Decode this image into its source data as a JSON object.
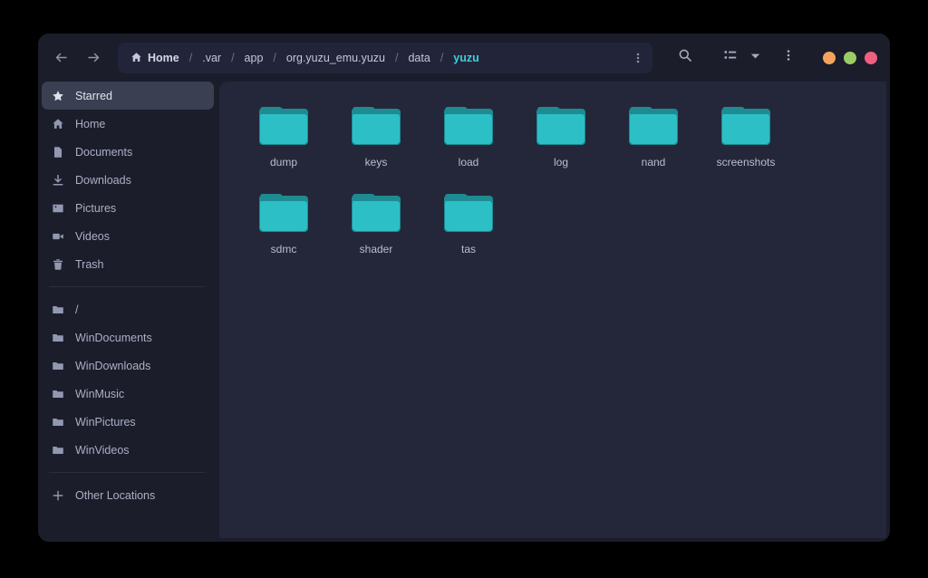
{
  "window": {
    "nav": {
      "back_label": "Back",
      "forward_label": "Forward"
    }
  },
  "breadcrumb": {
    "home_label": "Home",
    "separator": "/",
    "items": [
      {
        "label": "Home",
        "icon": "home-icon",
        "active": false
      },
      {
        "label": ".var",
        "active": false
      },
      {
        "label": "app",
        "active": false
      },
      {
        "label": "org.yuzu_emu.yuzu",
        "active": false
      },
      {
        "label": "data",
        "active": false
      },
      {
        "label": "yuzu",
        "active": true
      }
    ],
    "menu_icon": "kebab-menu-icon"
  },
  "toolbar": {
    "search_icon": "search-icon",
    "view_mode_icon": "list-view-icon",
    "view_dropdown_icon": "chevron-down-icon",
    "main_menu_icon": "kebab-menu-icon",
    "window_controls": [
      {
        "name": "minimize-button",
        "color": "#f5a35c"
      },
      {
        "name": "maximize-button",
        "color": "#9ccc65"
      },
      {
        "name": "close-button",
        "color": "#ef5f7f"
      }
    ]
  },
  "sidebar": {
    "groups": [
      {
        "items": [
          {
            "label": "Starred",
            "icon": "star-icon",
            "selected": true
          },
          {
            "label": "Home",
            "icon": "home-icon",
            "selected": false
          },
          {
            "label": "Documents",
            "icon": "document-icon",
            "selected": false
          },
          {
            "label": "Downloads",
            "icon": "download-icon",
            "selected": false
          },
          {
            "label": "Pictures",
            "icon": "image-icon",
            "selected": false
          },
          {
            "label": "Videos",
            "icon": "video-camera-icon",
            "selected": false
          },
          {
            "label": "Trash",
            "icon": "trash-icon",
            "selected": false
          }
        ]
      },
      {
        "items": [
          {
            "label": "/",
            "icon": "folder-icon",
            "selected": false
          },
          {
            "label": "WinDocuments",
            "icon": "folder-icon",
            "selected": false
          },
          {
            "label": "WinDownloads",
            "icon": "folder-icon",
            "selected": false
          },
          {
            "label": "WinMusic",
            "icon": "folder-icon",
            "selected": false
          },
          {
            "label": "WinPictures",
            "icon": "folder-icon",
            "selected": false
          },
          {
            "label": "WinVideos",
            "icon": "folder-icon",
            "selected": false
          }
        ]
      },
      {
        "items": [
          {
            "label": "Other Locations",
            "icon": "plus-icon",
            "selected": false
          }
        ]
      }
    ]
  },
  "files": [
    {
      "name": "dump",
      "type": "folder"
    },
    {
      "name": "keys",
      "type": "folder"
    },
    {
      "name": "load",
      "type": "folder"
    },
    {
      "name": "log",
      "type": "folder"
    },
    {
      "name": "nand",
      "type": "folder"
    },
    {
      "name": "screenshots",
      "type": "folder"
    },
    {
      "name": "sdmc",
      "type": "folder"
    },
    {
      "name": "shader",
      "type": "folder"
    },
    {
      "name": "tas",
      "type": "folder"
    }
  ],
  "colors": {
    "window_bg": "#1b1d2b",
    "content_bg": "#242739",
    "folder_front": "#2cbfc6",
    "folder_back": "#1e8b93",
    "accent_text": "#3fd0d8",
    "selected_row": "#3a3f52"
  }
}
